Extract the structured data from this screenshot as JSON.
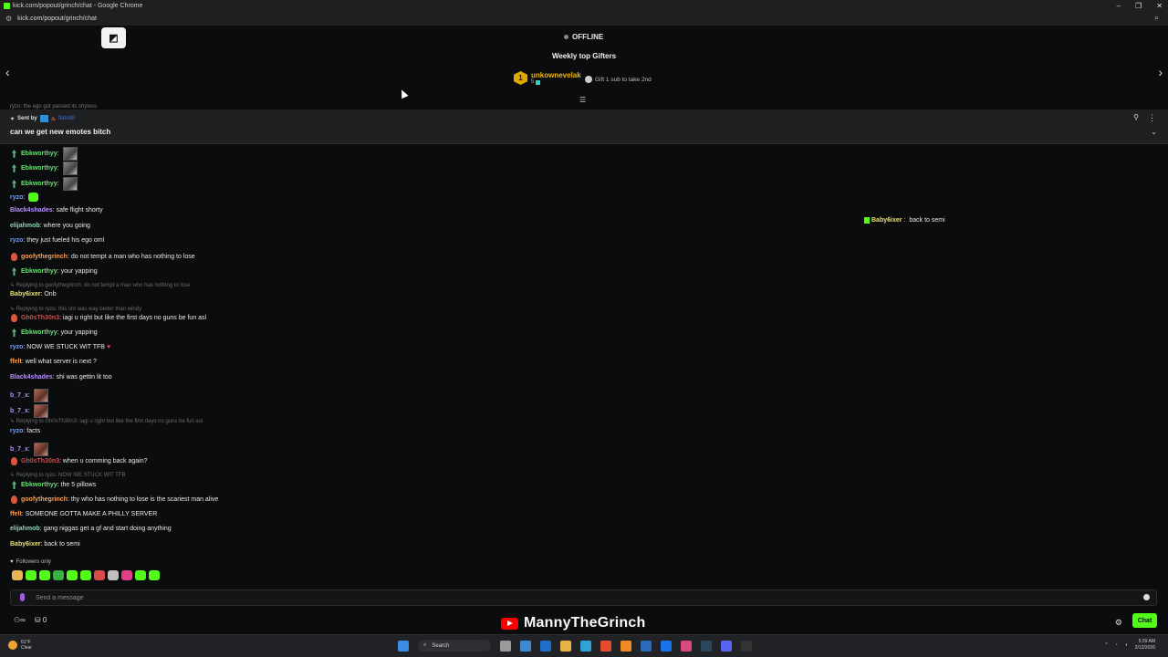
{
  "browser": {
    "window_title": "kick.com/popout/grinch/chat - Google Chrome",
    "url": "kick.com/popout/grinch/chat"
  },
  "stream": {
    "status": "OFFLINE"
  },
  "gifters": {
    "title": "Weekly top Gifters",
    "top": {
      "rank": "1",
      "name": "unkownevelak",
      "count": "5"
    },
    "cta": "Gift 1 sub to take 2nd"
  },
  "pinned": {
    "sent_by_label": "Sent by",
    "sent_by_user": "flatod8",
    "text": "can we get new emotes bitch"
  },
  "peek_text": "ryzo: the ego got passed its shyless",
  "messages": [
    {
      "badge": "green",
      "user": "Ebkworthyy",
      "color": "#6ddf7a",
      "text": "",
      "emote": "grey"
    },
    {
      "badge": "green",
      "user": "Ebkworthyy",
      "color": "#6ddf7a",
      "text": "",
      "emote": "grey"
    },
    {
      "badge": "green",
      "user": "Ebkworthyy",
      "color": "#6ddf7a",
      "text": "",
      "emote": "grey"
    },
    {
      "badge": "",
      "user": "ryzo",
      "color": "#7b9ff5",
      "text": "",
      "emote": "kick"
    },
    {
      "badge": "",
      "user": "Black4shades",
      "color": "#b692f5",
      "text": "safe flight shorty"
    },
    {
      "badge": "",
      "user": "elijahmob",
      "color": "#8fd6b3",
      "text": "where you going"
    },
    {
      "badge": "",
      "user": "ryzo",
      "color": "#7b9ff5",
      "text": "they just fueled his ego oml"
    },
    {
      "badge": "red",
      "user": "goofythegrinch",
      "color": "#f1a05a",
      "text": "do not tempt a man who has nothing to lose"
    },
    {
      "badge": "green",
      "user": "Ebkworthyy",
      "color": "#6ddf7a",
      "text": "your yapping"
    },
    {
      "reply": "Replying to goofythegrinch: do not tempt a man who has nothing to lose"
    },
    {
      "badge": "",
      "user": "Baby6ixer",
      "color": "#e8e07a",
      "text": "Onb"
    },
    {
      "reply": "Replying to ryzo: this sht was way better than windy"
    },
    {
      "badge": "red",
      "user": "Gh0sTh30n3",
      "color": "#d94a4a",
      "text": "iagi u right but like the first days no guns be fun asl"
    },
    {
      "badge": "green",
      "user": "Ebkworthyy",
      "color": "#6ddf7a",
      "text": "your yapping"
    },
    {
      "badge": "",
      "user": "ryzo",
      "color": "#7b9ff5",
      "text": "NOW WE STUCK WIT TFB",
      "heart": true
    },
    {
      "badge": "",
      "user": "ffelt",
      "color": "#f1a05a",
      "text": "well what server is next ?"
    },
    {
      "badge": "",
      "user": "Black4shades",
      "color": "#b692f5",
      "text": "shi was gettin lit too"
    },
    {
      "badge": "",
      "user": "b_7_x",
      "color": "#b692f5",
      "text": "",
      "emote": "brown"
    },
    {
      "badge": "",
      "user": "b_7_x",
      "color": "#b692f5",
      "text": "",
      "emote": "brown"
    },
    {
      "reply": "Replying to Gh0sTh30n3: iagi u right but like the first days no guns be fun asl"
    },
    {
      "badge": "",
      "user": "ryzo",
      "color": "#7b9ff5",
      "text": "facts"
    },
    {
      "badge": "",
      "user": "b_7_x",
      "color": "#b692f5",
      "text": "",
      "emote": "brown"
    },
    {
      "badge": "red",
      "user": "Gh0sTh30n3",
      "color": "#d94a4a",
      "text": "when u comming back again?"
    },
    {
      "reply": "Replying to ryzo: NOW WE STUCK WIT TFB"
    },
    {
      "badge": "green",
      "user": "Ebkworthyy",
      "color": "#6ddf7a",
      "text": "the 5 pillows"
    },
    {
      "badge": "red",
      "user": "goofythegrinch",
      "color": "#f1a05a",
      "text": "thy who has nothing to lose is the scariest man alive"
    },
    {
      "badge": "",
      "user": "ffelt",
      "color": "#f1a05a",
      "text": "SOMEONE GOTTA MAKE A PHILLY SERVER"
    },
    {
      "badge": "",
      "user": "elijahmob",
      "color": "#8fd6b3",
      "text": "gang niggas get a gf and start doing anything"
    },
    {
      "badge": "",
      "user": "Baby6ixer",
      "color": "#e8e07a",
      "text": "back to semi"
    }
  ],
  "overlay": {
    "user": "Baby6ixer",
    "text": "back to semi"
  },
  "followers_only": "Followers only",
  "emote_colors": [
    "#e7b455",
    "#53fc18",
    "#53fc18",
    "#3cb043",
    "#53fc18",
    "#53fc18",
    "#d94a4a",
    "#bfbfbf",
    "#e23e8a",
    "#53fc18",
    "#53fc18"
  ],
  "input": {
    "placeholder": "Send a message"
  },
  "bottom": {
    "viewers": "0",
    "chat_button": "Chat",
    "brand_name": "MannyTheGrinch"
  },
  "taskbar": {
    "weather_temp": "61°F",
    "weather_desc": "Clear",
    "search_label": "Search",
    "time": "5:39 AM",
    "date": "2/12/2026"
  },
  "colors": {
    "kick_green": "#53fc18",
    "background": "#0b0c0d",
    "gold": "#f2b705"
  }
}
